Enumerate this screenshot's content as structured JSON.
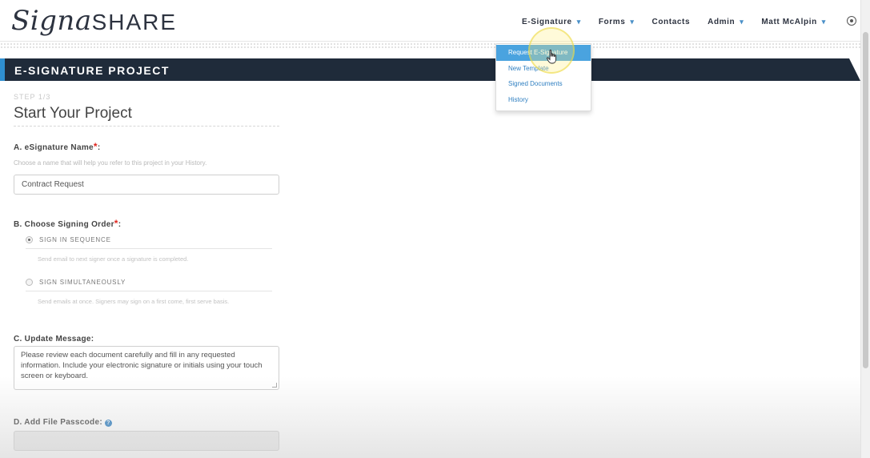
{
  "logo": {
    "script": "Signa",
    "caps": "SHARE"
  },
  "nav": {
    "items": [
      {
        "label": "E-Signature",
        "caret": "▾"
      },
      {
        "label": "Forms",
        "caret": "▾"
      },
      {
        "label": "Contacts",
        "caret": ""
      },
      {
        "label": "Admin",
        "caret": "▾"
      },
      {
        "label": "Matt McAlpin",
        "caret": "▾"
      }
    ]
  },
  "dropdown": {
    "items": [
      {
        "label": "Request E-Signature"
      },
      {
        "label": "New Template"
      },
      {
        "label": "Signed Documents"
      },
      {
        "label": "History"
      }
    ]
  },
  "banner": {
    "title": "E-SIGNATURE PROJECT"
  },
  "step": {
    "label": "STEP 1/3",
    "title": "Start Your Project"
  },
  "sections": {
    "name": {
      "label": "A. eSignature Name",
      "required": "*",
      "colon": ":",
      "hint": "Choose a name that will help you refer to this project in your History.",
      "value": "Contract Request"
    },
    "order": {
      "label": "B. Choose Signing Order",
      "required": "*",
      "colon": ":",
      "options": [
        {
          "label": "SIGN IN SEQUENCE",
          "desc": "Send email to next signer once a signature is completed."
        },
        {
          "label": "SIGN SIMULTANEOUSLY",
          "desc": "Send emails at once. Signers may sign on a first come, first serve basis."
        }
      ]
    },
    "message": {
      "label": "C. Update Message:",
      "value": "Please review each document carefully and fill in any requested information. Include your electronic signature or initials using your touch screen or keyboard."
    },
    "passcode": {
      "label": "D. Add File Passcode:",
      "info": "?"
    }
  }
}
